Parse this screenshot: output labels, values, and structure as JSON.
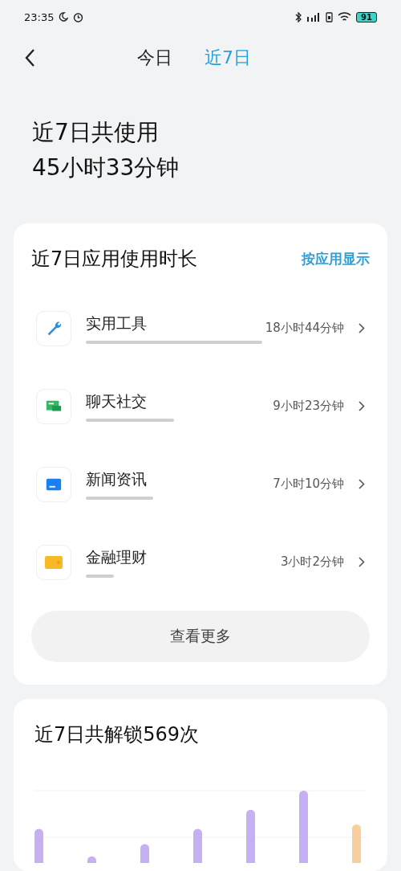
{
  "status_bar": {
    "time": "23:35",
    "battery": "91"
  },
  "tabs": [
    {
      "label": "今日",
      "selected": false
    },
    {
      "label": "近7日",
      "selected": true
    }
  ],
  "summary": {
    "line_1": "近7日共使用",
    "line_2": "45小时33分钟"
  },
  "usage_card": {
    "title": "近7日应用使用时长",
    "toggle": "按应用显示",
    "categories": [
      {
        "kind": "tools",
        "name": "实用工具",
        "duration": "18小时44分钟"
      },
      {
        "kind": "chat",
        "name": "聊天社交",
        "duration": "9小时23分钟"
      },
      {
        "kind": "news",
        "name": "新闻资讯",
        "duration": "7小时10分钟"
      },
      {
        "kind": "finance",
        "name": "金融理财",
        "duration": "3小时2分钟"
      }
    ],
    "more_button": "查看更多"
  },
  "unlock_card": {
    "title": "近7日共解锁569次"
  }
}
